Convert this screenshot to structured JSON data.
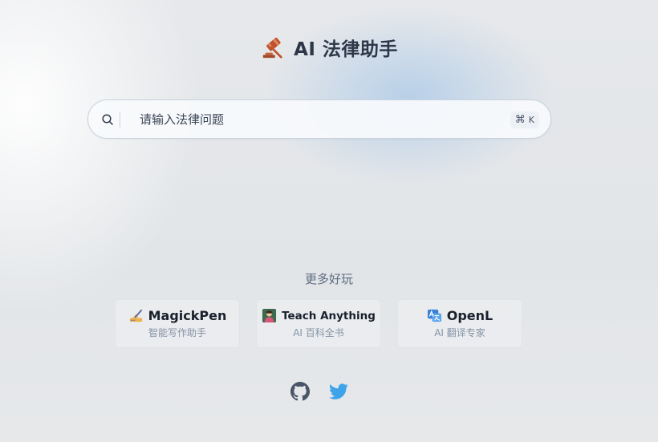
{
  "header": {
    "icon": "gavel-icon",
    "title": "AI 法律助手"
  },
  "search": {
    "placeholder": "请输入法律问题",
    "value": "",
    "shortcut_symbol": "⌘",
    "shortcut_key": "K",
    "icon": "search-icon"
  },
  "more": {
    "title": "更多好玩",
    "apps": [
      {
        "name": "MagickPen",
        "subtitle": "智能写作助手",
        "icon": "writing-hand-icon"
      },
      {
        "name": "Teach Anything",
        "subtitle": "AI 百科全书",
        "icon": "teacher-icon"
      },
      {
        "name": "OpenL",
        "subtitle": "AI 翻译专家",
        "icon": "translate-icon"
      }
    ]
  },
  "footer": {
    "links": [
      {
        "name": "github-icon",
        "color": "#4a5568"
      },
      {
        "name": "twitter-icon",
        "color": "#3fa3ea"
      }
    ]
  },
  "colors": {
    "title": "#2d3748",
    "subtitle": "#8593a6",
    "accent_glow": "#b0cce8"
  }
}
